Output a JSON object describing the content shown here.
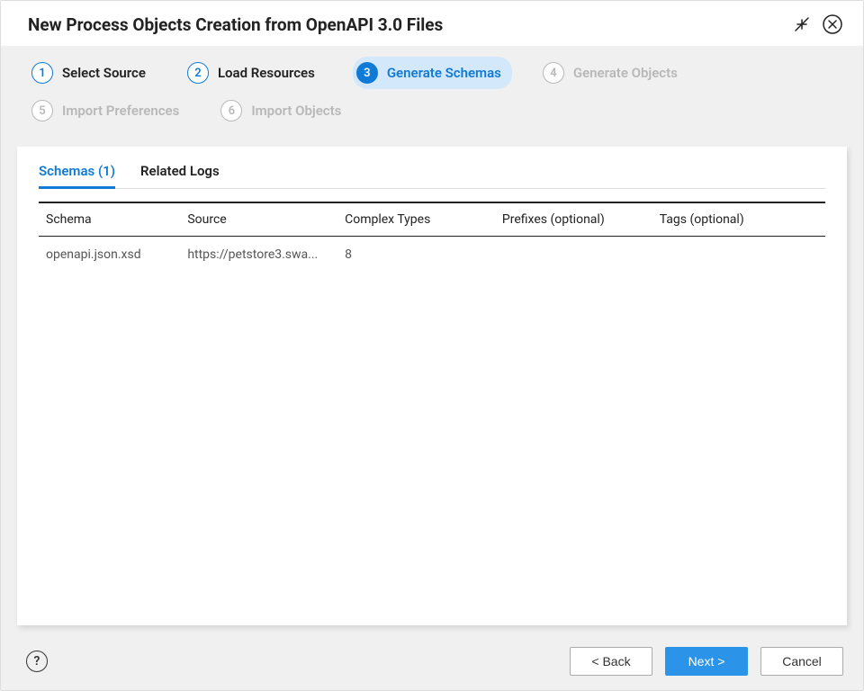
{
  "header": {
    "title": "New Process Objects Creation from OpenAPI 3.0 Files"
  },
  "steps": [
    {
      "num": "1",
      "label": "Select Source",
      "state": "done"
    },
    {
      "num": "2",
      "label": "Load Resources",
      "state": "done"
    },
    {
      "num": "3",
      "label": "Generate Schemas",
      "state": "active"
    },
    {
      "num": "4",
      "label": "Generate Objects",
      "state": "disabled"
    },
    {
      "num": "5",
      "label": "Import Preferences",
      "state": "disabled"
    },
    {
      "num": "6",
      "label": "Import Objects",
      "state": "disabled"
    }
  ],
  "tabs": {
    "schemas": "Schemas (1)",
    "logs": "Related Logs"
  },
  "table": {
    "headers": {
      "schema": "Schema",
      "source": "Source",
      "complex": "Complex Types",
      "prefixes": "Prefixes (optional)",
      "tags": "Tags (optional)"
    },
    "rows": [
      {
        "schema": "openapi.json.xsd",
        "source": "https://petstore3.swa...",
        "complex": "8",
        "prefixes": "",
        "tags": ""
      }
    ]
  },
  "footer": {
    "back": "< Back",
    "next": "Next >",
    "cancel": "Cancel",
    "help": "?"
  }
}
